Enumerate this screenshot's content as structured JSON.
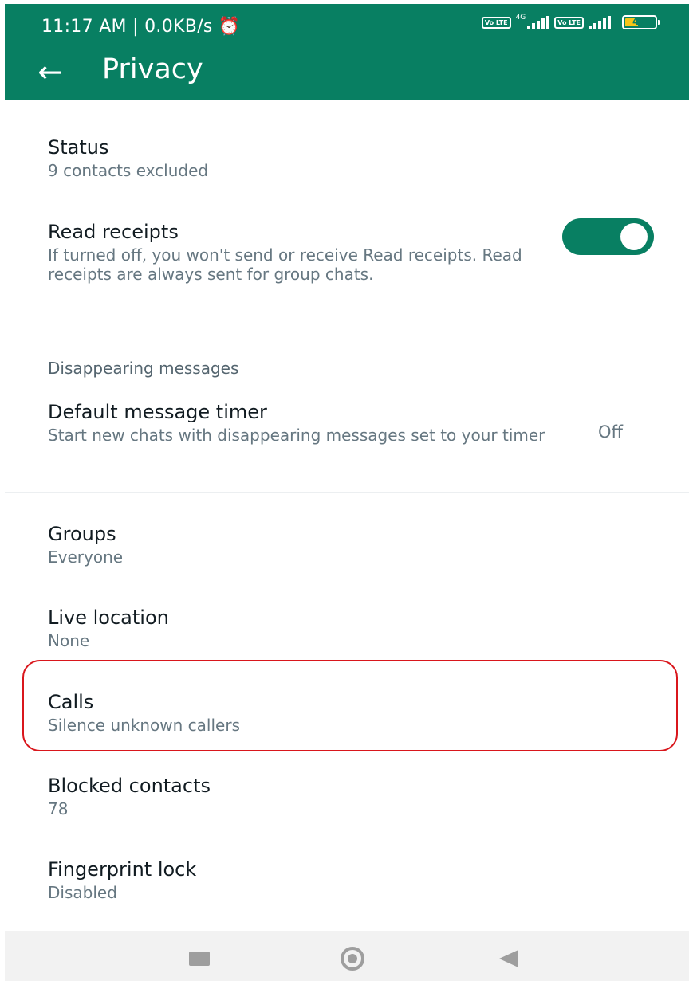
{
  "status_bar": {
    "time_and_speed": "11:17 AM | 0.0KB/s ⏰",
    "volte_label": "Vo LTE",
    "network_label": "4G",
    "battery_level": "40"
  },
  "appbar": {
    "back_icon": "arrow-left-icon",
    "title": "Privacy",
    "color": "#087f62"
  },
  "settings": {
    "status": {
      "title": "Status",
      "subtitle": "9 contacts excluded"
    },
    "read_receipts": {
      "title": "Read receipts",
      "subtitle": "If turned off, you won't send or receive Read receipts. Read receipts are always sent for group chats.",
      "toggle_on": true
    },
    "disappearing_header": "Disappearing messages",
    "default_timer": {
      "title": "Default message timer",
      "subtitle": "Start new chats with disappearing messages set to your timer",
      "value": "Off"
    },
    "groups": {
      "title": "Groups",
      "subtitle": "Everyone"
    },
    "live_location": {
      "title": "Live location",
      "subtitle": "None"
    },
    "calls": {
      "title": "Calls",
      "subtitle": "Silence unknown callers"
    },
    "blocked": {
      "title": "Blocked contacts",
      "subtitle": "78"
    },
    "fingerprint": {
      "title": "Fingerprint lock",
      "subtitle": "Disabled"
    }
  },
  "highlight_color": "#d9161c",
  "nav_bar": {
    "recents_icon": "square-recents-icon",
    "home_icon": "circle-home-icon",
    "back_icon": "triangle-back-icon"
  }
}
